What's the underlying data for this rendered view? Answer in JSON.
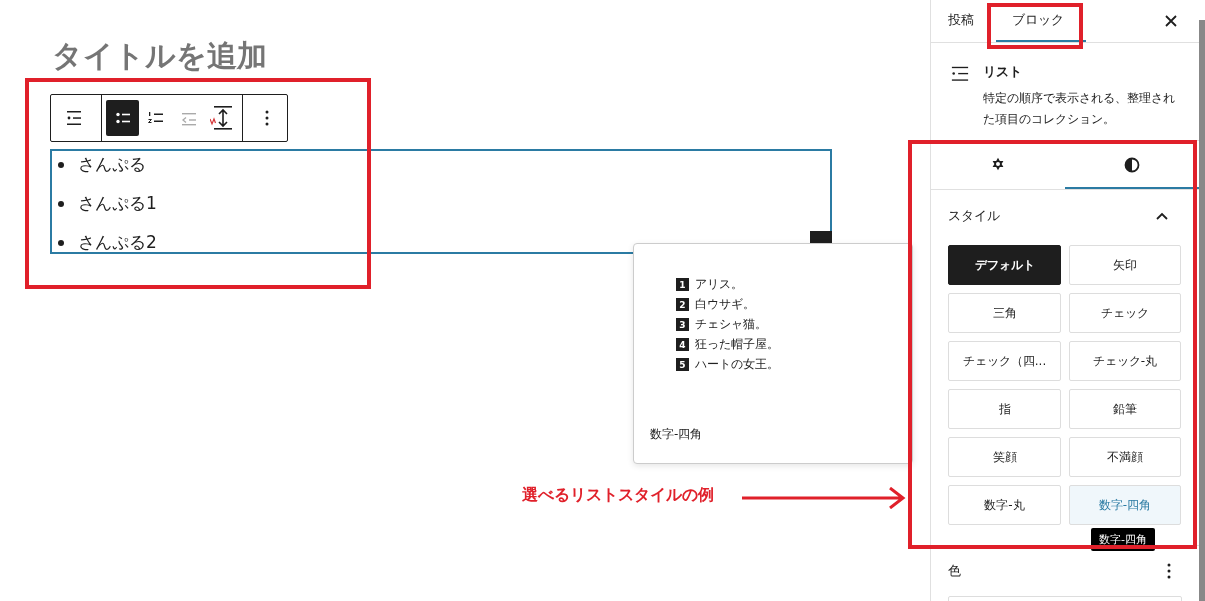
{
  "editor": {
    "title_placeholder": "タイトルを追加",
    "toolbar": [
      {
        "kind": "list-view",
        "selected": false,
        "disabled": false
      },
      {
        "kind": "unordered",
        "selected": true,
        "disabled": false
      },
      {
        "kind": "ordered",
        "selected": false,
        "disabled": false
      },
      {
        "kind": "outdent",
        "selected": false,
        "disabled": true
      },
      {
        "kind": "spacing",
        "selected": false,
        "disabled": false
      },
      {
        "kind": "more",
        "selected": false,
        "disabled": false
      }
    ],
    "list_items": [
      "さんぷる",
      "さんぷる1",
      "さんぷる2"
    ]
  },
  "preview": {
    "items": [
      {
        "number": "1",
        "text": "アリス。"
      },
      {
        "number": "2",
        "text": "白ウサギ。"
      },
      {
        "number": "3",
        "text": "チェシャ猫。"
      },
      {
        "number": "4",
        "text": "狂った帽子屋。"
      },
      {
        "number": "5",
        "text": "ハートの女王。"
      }
    ],
    "label": "数字-四角"
  },
  "annotation": {
    "text": "選べるリストスタイルの例"
  },
  "sidebar": {
    "tabs": [
      {
        "label": "投稿",
        "selected": false
      },
      {
        "label": "ブロック",
        "selected": true
      }
    ],
    "block": {
      "name": "リスト",
      "description": "特定の順序で表示される、整理された項目のコレクション。"
    },
    "subtabs": [
      {
        "kind": "settings",
        "selected": false
      },
      {
        "kind": "styles",
        "selected": true
      }
    ],
    "styles_heading": "スタイル",
    "expanded": true,
    "styles": [
      {
        "label": "デフォルト",
        "selected": true,
        "highlighted": false
      },
      {
        "label": "矢印",
        "selected": false,
        "highlighted": false
      },
      {
        "label": "三角",
        "selected": false,
        "highlighted": false
      },
      {
        "label": "チェック",
        "selected": false,
        "highlighted": false
      },
      {
        "label": "チェック（四...",
        "selected": false,
        "highlighted": false
      },
      {
        "label": "チェック-丸",
        "selected": false,
        "highlighted": false
      },
      {
        "label": "指",
        "selected": false,
        "highlighted": false
      },
      {
        "label": "鉛筆",
        "selected": false,
        "highlighted": false
      },
      {
        "label": "笑顔",
        "selected": false,
        "highlighted": false
      },
      {
        "label": "不満顔",
        "selected": false,
        "highlighted": false
      },
      {
        "label": "数字-丸",
        "selected": false,
        "highlighted": false
      },
      {
        "label": "数字-四角",
        "selected": false,
        "highlighted": true
      }
    ],
    "tooltip": "数字-四角",
    "color_heading": "色"
  }
}
